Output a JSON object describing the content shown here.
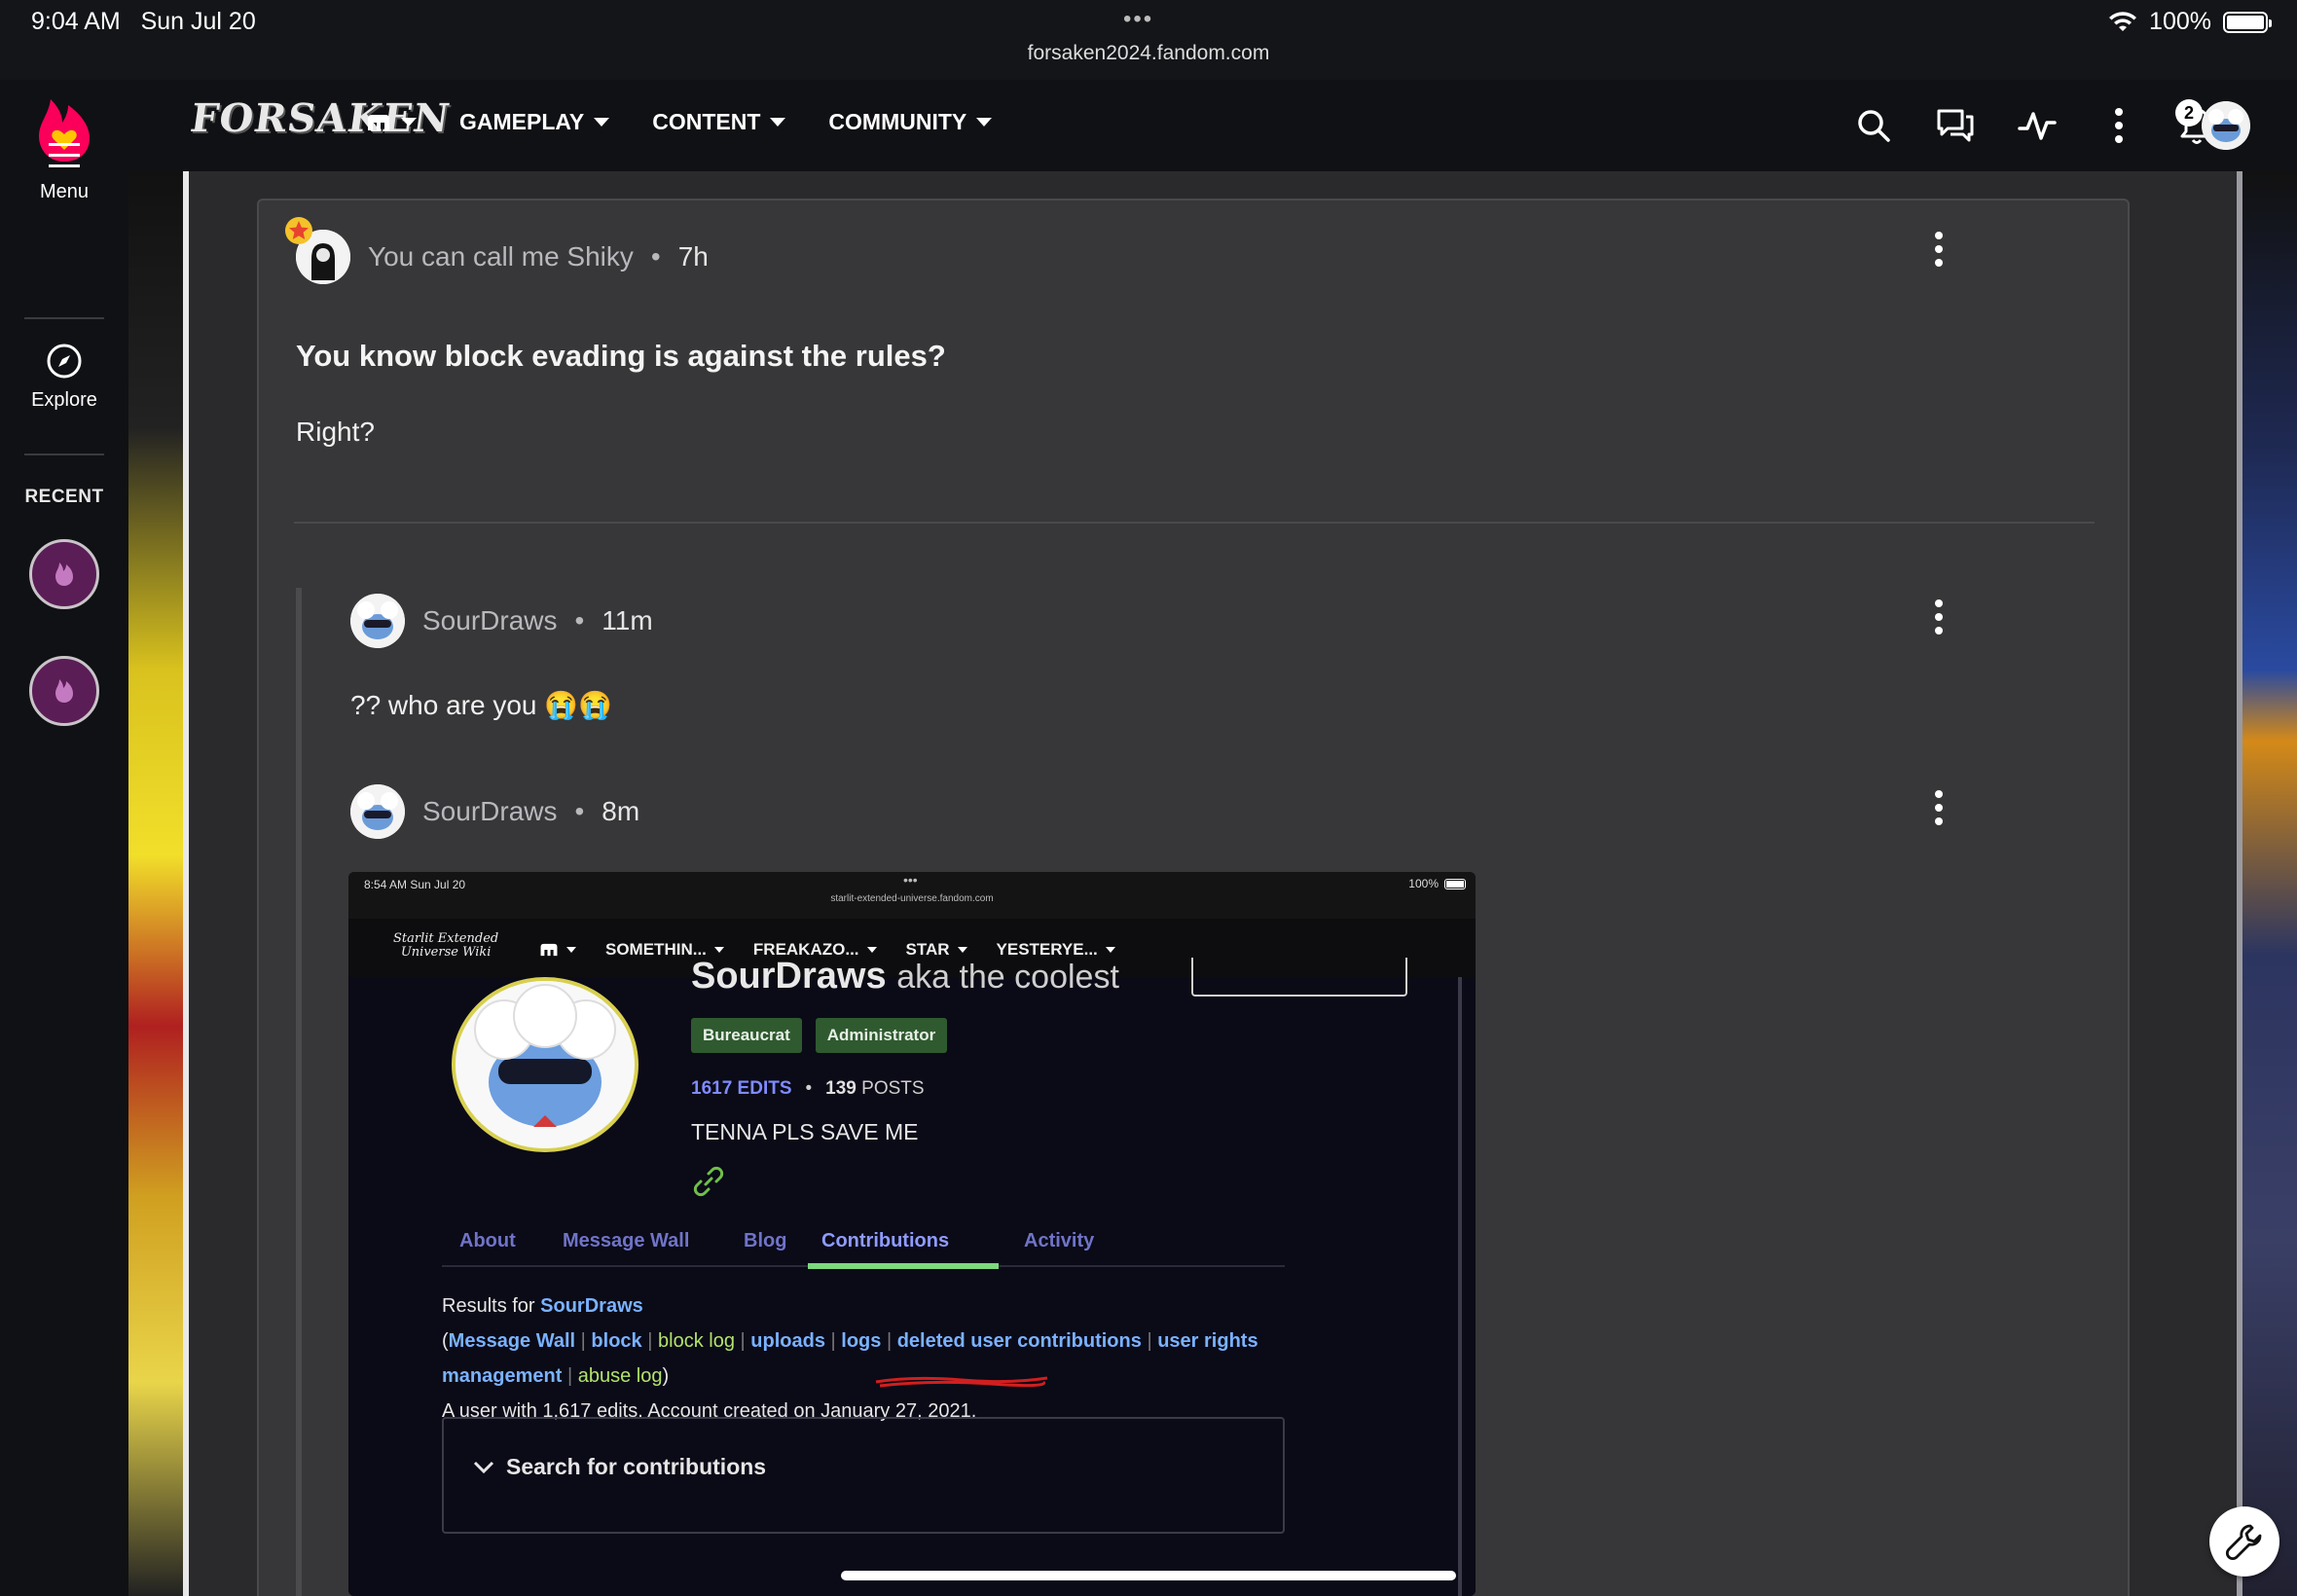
{
  "status_bar": {
    "time": "9:04 AM",
    "date": "Sun Jul 20",
    "url": "forsaken2024.fandom.com",
    "battery": "100%"
  },
  "rail": {
    "menu_label": "Menu",
    "explore_label": "Explore",
    "recent_label": "RECENT"
  },
  "topnav": {
    "wiki_logo_text": "FORSAKEN",
    "items": [
      {
        "label": ""
      },
      {
        "label": "GAMEPLAY"
      },
      {
        "label": "CONTENT"
      },
      {
        "label": "COMMUNITY"
      }
    ],
    "notification_count": "2"
  },
  "post": {
    "author": "You can call me Shiky",
    "time": "7h",
    "title": "You know block evading is against the rules?",
    "body": "Right?"
  },
  "replies": [
    {
      "author": "SourDraws",
      "time": "11m",
      "text": "?? who are you 😭😭"
    },
    {
      "author": "SourDraws",
      "time": "8m",
      "text": ""
    }
  ],
  "embed": {
    "time": "8:54 AM   Sun Jul 20",
    "url": "starlit-extended-universe.fandom.com",
    "battery": "100%",
    "logo_line1": "Starlit Extended",
    "logo_line2": "Universe Wiki",
    "menu": [
      "SOMETHIN...",
      "FREAKAZO...",
      "STAR",
      "YESTERYE..."
    ],
    "profile_name": "SourDraws",
    "profile_suffix": "aka the coolest",
    "tags": [
      "Bureaucrat",
      "Administrator"
    ],
    "edits": "1617 EDITS",
    "posts_count": "139",
    "posts_label": "POSTS",
    "bio": "TENNA PLS SAVE ME",
    "tabs": [
      "About",
      "Message Wall",
      "Blog",
      "Contributions",
      "Activity"
    ],
    "active_tab": "Contributions",
    "results_prefix": "Results for",
    "results_user": "SourDraws",
    "links_1": [
      "Message Wall",
      "block",
      "block log",
      "uploads",
      "logs",
      "deleted user contributions",
      "user rights"
    ],
    "links_2": [
      "management",
      "abuse log"
    ],
    "account_line": "A user with 1,617 edits. Account created on January 27, 2021.",
    "search_label": "Search for contributions"
  }
}
